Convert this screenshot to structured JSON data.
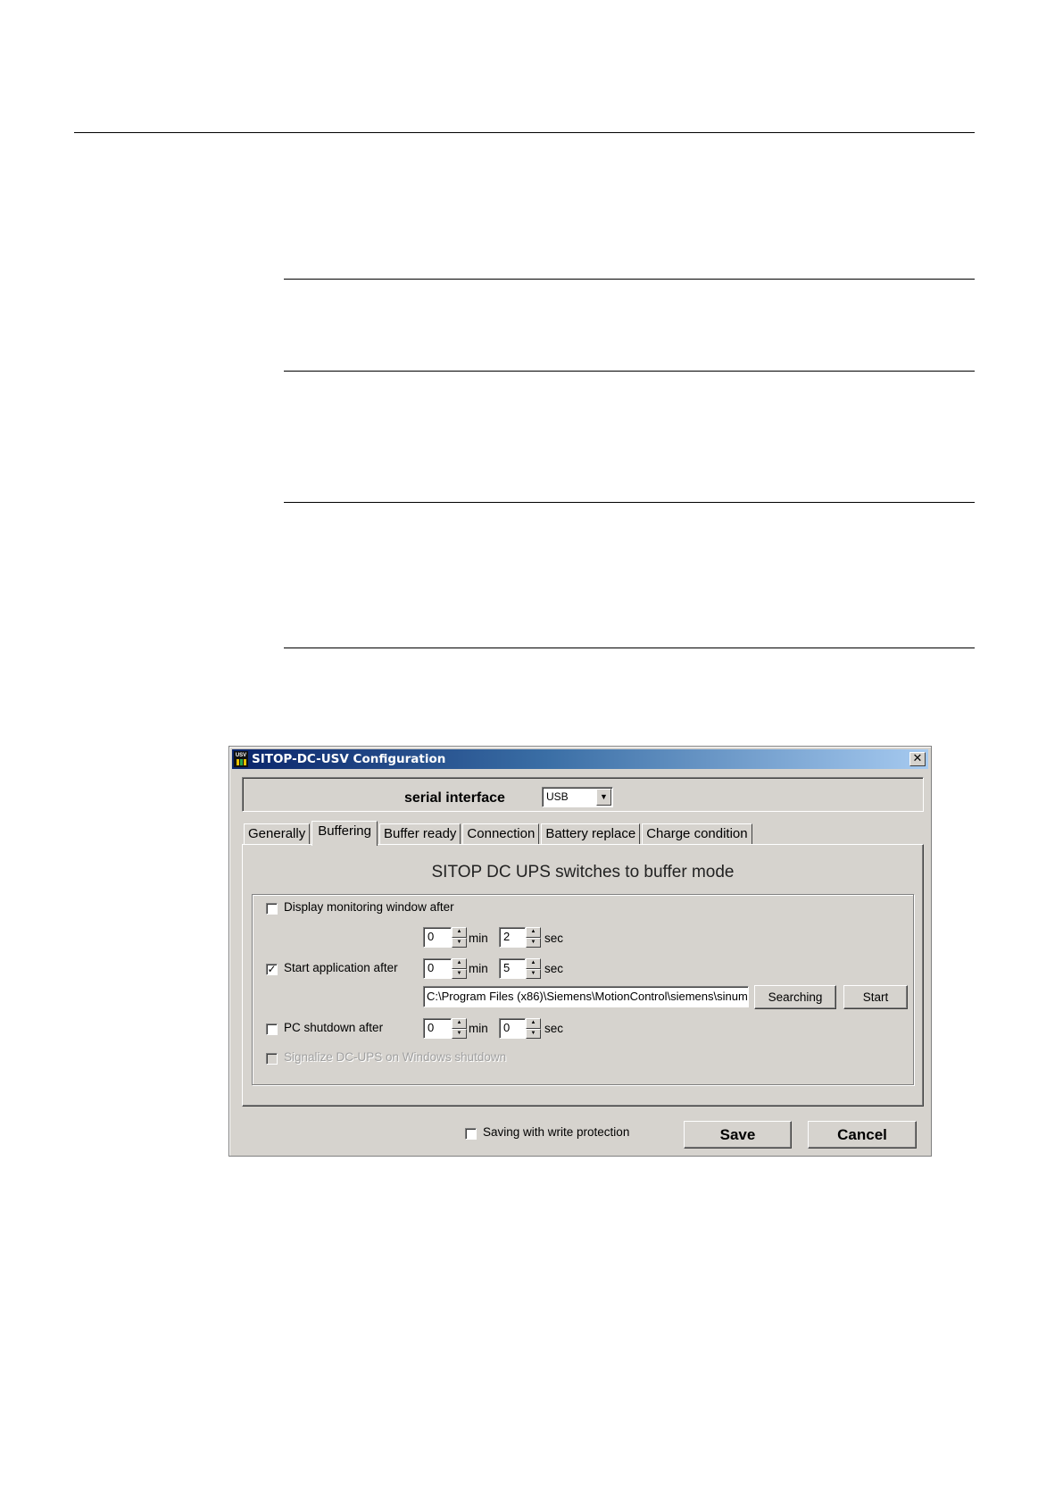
{
  "dialog": {
    "title": "SITOP-DC-USV Configuration",
    "icon_text": "USV",
    "close_label": "✕"
  },
  "serial": {
    "label": "serial interface",
    "value": "USB"
  },
  "tabs": [
    {
      "label": "Generally"
    },
    {
      "label": "Buffering"
    },
    {
      "label": "Buffer ready"
    },
    {
      "label": "Connection"
    },
    {
      "label": "Battery replace"
    },
    {
      "label": "Charge condition"
    }
  ],
  "active_tab": "Buffering",
  "panel": {
    "title": "SITOP DC UPS switches to buffer mode",
    "display_monitoring": {
      "label": "Display monitoring window after",
      "checked": "",
      "min": "0",
      "sec": "2"
    },
    "start_application": {
      "label": "Start application after",
      "checked": "✓",
      "min": "0",
      "sec": "5",
      "path": "C:\\Program Files (x86)\\Siemens\\MotionControl\\siemens\\sinum",
      "searching_label": "Searching",
      "start_label": "Start"
    },
    "pc_shutdown": {
      "label": "PC shutdown after",
      "checked": "",
      "min": "0",
      "sec": "0"
    },
    "signalize": {
      "label": "Signalize DC-UPS on Windows shutdown",
      "checked": ""
    },
    "units": {
      "min": "min",
      "sec": "sec"
    }
  },
  "footer": {
    "write_protection_label": "Saving with write protection",
    "write_protection_checked": "",
    "save_label": "Save",
    "cancel_label": "Cancel"
  },
  "colors": {
    "dialog_bg": "#d6d3ce",
    "titlebar_start": "#0a246a",
    "titlebar_end": "#a6caf0"
  }
}
